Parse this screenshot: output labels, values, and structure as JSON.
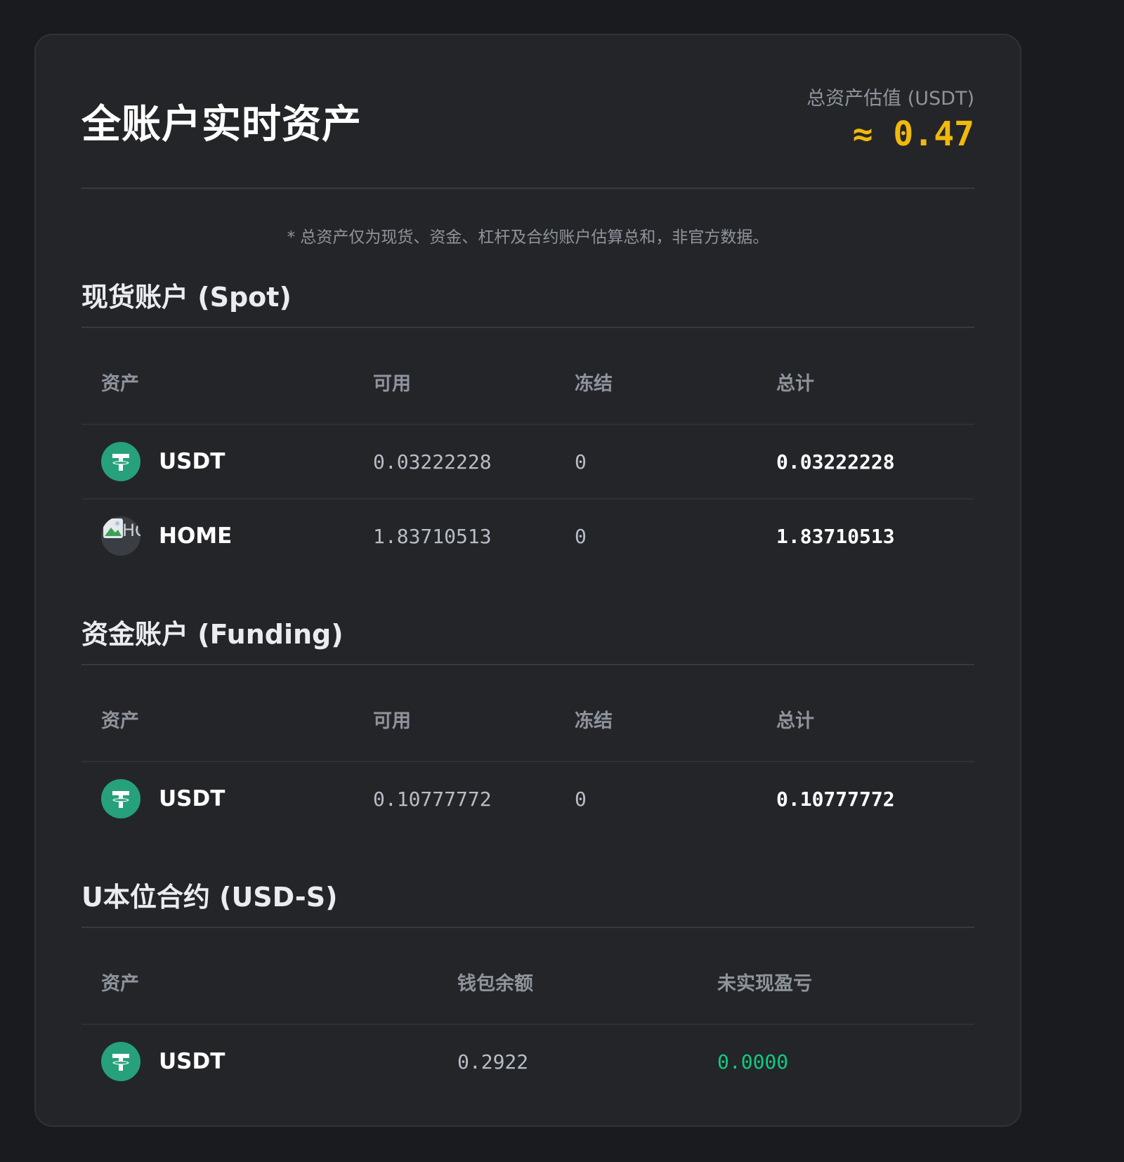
{
  "header": {
    "title": "全账户实时资产",
    "total_label": "总资产估值 (USDT)",
    "total_value": "≈ 0.47"
  },
  "note": "* 总资产仅为现货、资金、杠杆及合约账户估算总和，非官方数据。",
  "colors": {
    "accent": "#f0b90b",
    "profit": "#0ecb81",
    "usdt_icon": "#26a17b",
    "card_bg": "#232529"
  },
  "spot": {
    "title": "现货账户 (Spot)",
    "columns": [
      "资产",
      "可用",
      "冻结",
      "总计"
    ],
    "rows": [
      {
        "asset": "USDT",
        "icon": "tether-icon",
        "available": "0.03222228",
        "frozen": "0",
        "total": "0.03222228"
      },
      {
        "asset": "HOME",
        "icon": "broken-image-icon",
        "icon_alt": "HO",
        "available": "1.83710513",
        "frozen": "0",
        "total": "1.83710513"
      }
    ]
  },
  "funding": {
    "title": "资金账户 (Funding)",
    "columns": [
      "资产",
      "可用",
      "冻结",
      "总计"
    ],
    "rows": [
      {
        "asset": "USDT",
        "icon": "tether-icon",
        "available": "0.10777772",
        "frozen": "0",
        "total": "0.10777772"
      }
    ]
  },
  "futures": {
    "title": "U本位合约 (USD-S)",
    "columns": [
      "资产",
      "钱包余额",
      "未实现盈亏"
    ],
    "rows": [
      {
        "asset": "USDT",
        "icon": "tether-icon",
        "wallet_balance": "0.2922",
        "unrealized_pnl": "0.0000"
      }
    ]
  }
}
